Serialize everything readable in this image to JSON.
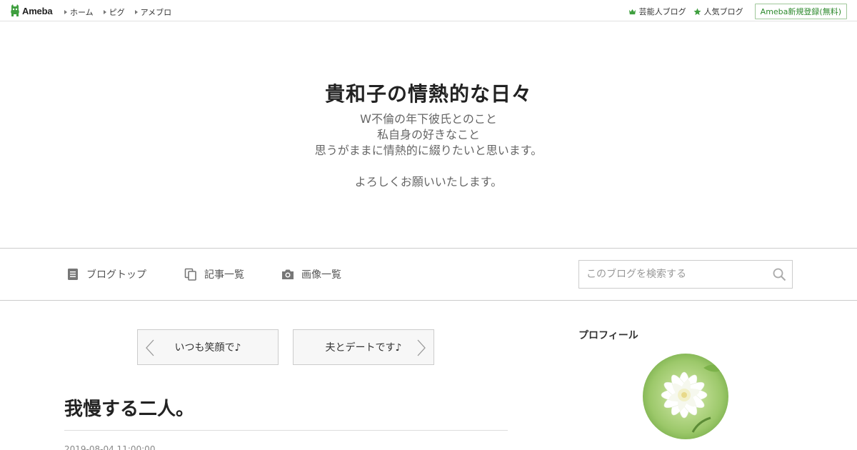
{
  "topbar": {
    "logo": "Ameba",
    "nav": [
      "ホーム",
      "ピグ",
      "アメブロ"
    ],
    "right_links": [
      {
        "icon": "crown-icon",
        "label": "芸能人ブログ"
      },
      {
        "icon": "star-icon",
        "label": "人気ブログ"
      }
    ],
    "signup_label": "Ameba新規登録(無料)"
  },
  "header": {
    "title": "貴和子の情熱的な日々",
    "description": "W不倫の年下彼氏とのこと\n私自身の好きなこと\n思うがままに情熱的に綴りたいと思います。\n\nよろしくお願いいたします。"
  },
  "global_nav": {
    "items": [
      {
        "icon": "document-icon",
        "label": "ブログトップ"
      },
      {
        "icon": "copy-icon",
        "label": "記事一覧"
      },
      {
        "icon": "camera-icon",
        "label": "画像一覧"
      }
    ],
    "search_placeholder": "このブログを検索する"
  },
  "pager": {
    "prev_label": "いつも笑顔で♪",
    "next_label": "夫とデートです♪"
  },
  "article": {
    "title": "我慢する二人。",
    "date": "2019-08-04 11:00:00"
  },
  "sidebar": {
    "heading": "プロフィール"
  },
  "colors": {
    "brand_green": "#2d8a2d",
    "border": "#cccccc"
  }
}
